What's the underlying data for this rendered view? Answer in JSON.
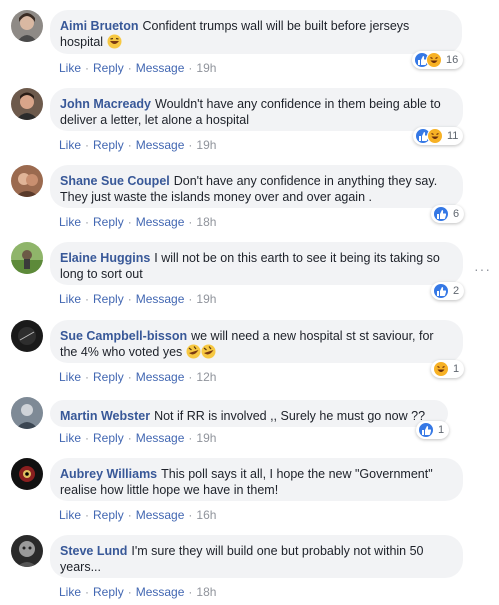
{
  "actions": {
    "like": "Like",
    "reply": "Reply",
    "message": "Message",
    "separator": "·"
  },
  "more_menu": "···",
  "colors": {
    "name": "#385898",
    "link": "#4267b2",
    "bubble": "#f2f3f5",
    "like": "#3578e5",
    "haha": "#f7b125"
  },
  "comments": [
    {
      "name": "Aimi Brueton",
      "text": "Confident trumps wall will be built before jerseys hospital",
      "emoji": "laughing-face",
      "time": "19h",
      "reactions": [
        "like",
        "haha"
      ],
      "count": "16"
    },
    {
      "name": "John Macready",
      "text": "Wouldn't have any confidence in them being able to deliver a letter, let alone a hospital",
      "time": "19h",
      "reactions": [
        "like",
        "haha"
      ],
      "count": "11"
    },
    {
      "name": "Shane Sue Coupel",
      "text": "Don't have any confidence in anything they say. They just waste the islands money over and over again .",
      "time": "18h",
      "reactions": [
        "like"
      ],
      "count": "6"
    },
    {
      "name": "Elaine Huggins",
      "text": "I will not be on this earth to see it being its taking so long to sort out",
      "time": "19h",
      "reactions": [
        "like"
      ],
      "count": "2"
    },
    {
      "name": "Sue Campbell-bisson",
      "text": "we will need a new hospital st st saviour, for the 4% who voted yes",
      "emoji": "rofl-face",
      "time": "12h",
      "reactions": [
        "haha"
      ],
      "count": "1"
    },
    {
      "name": "Martin Webster",
      "text": "Not if RR is involved ,, Surely he must go now ??",
      "time": "19h",
      "reactions": [
        "like"
      ],
      "count": "1"
    },
    {
      "name": "Aubrey Williams",
      "text": "This poll says it all, I hope the new \"Government\" realise how little hope we have in them!",
      "time": "16h",
      "reactions": [],
      "count": ""
    },
    {
      "name": "Steve Lund",
      "text": "I'm sure they will build one but probably not within 50 years...",
      "time": "18h",
      "reactions": [],
      "count": ""
    }
  ]
}
